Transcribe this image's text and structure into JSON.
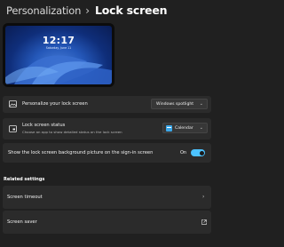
{
  "breadcrumb": {
    "parent": "Personalization",
    "separator": "›",
    "current": "Lock screen"
  },
  "preview": {
    "time": "12:17",
    "date": "Saturday, June 11"
  },
  "settings": {
    "personalize": {
      "label": "Personalize your lock screen",
      "value": "Windows spotlight",
      "icon": "image-icon"
    },
    "status": {
      "label": "Lock screen status",
      "description": "Choose an app to show detailed status on the lock screen",
      "value": "Calendar",
      "icon": "status-card-icon",
      "app_icon": "calendar-icon"
    },
    "signin_background": {
      "label": "Show the lock screen background picture on the sign-in screen",
      "toggle_label": "On",
      "toggle_on": true
    }
  },
  "related": {
    "heading": "Related settings",
    "items": [
      {
        "label": "Screen timeout",
        "icon": "chevron-right-icon"
      },
      {
        "label": "Screen saver",
        "icon": "open-external-icon"
      }
    ]
  },
  "colors": {
    "background": "#202020",
    "card": "#2b2b2b",
    "accent": "#4cc2ff"
  }
}
